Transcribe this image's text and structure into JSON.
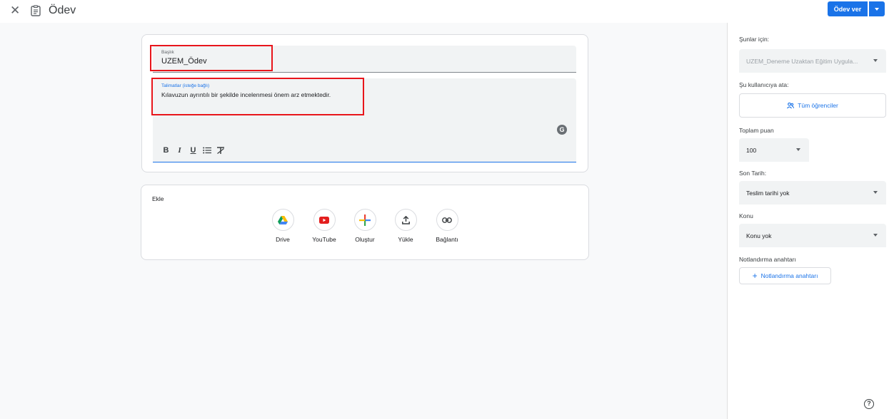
{
  "header": {
    "close_glyph": "✕",
    "title": "Ödev",
    "assign_label": "Ödev ver"
  },
  "form": {
    "title_label": "Başlık",
    "title_value": "UZEM_Ödev",
    "instructions_label": "Talimatlar (isteğe bağlı)",
    "instructions_value": "Kılavuzun ayrıntılı bir şekilde incelenmesi önem arz etmektedir.",
    "grammarly_glyph": "G",
    "toolbar": [
      {
        "name": "bold-button",
        "glyph": "B"
      },
      {
        "name": "italic-button",
        "glyph": "I"
      },
      {
        "name": "underline-button",
        "glyph": "U"
      },
      {
        "name": "bulleted-list-button",
        "glyph": "☰"
      },
      {
        "name": "clear-formatting-button",
        "glyph": "T̸"
      }
    ]
  },
  "attach": {
    "label": "Ekle",
    "items": [
      {
        "label": "Drive",
        "icon": "drive-icon"
      },
      {
        "label": "YouTube",
        "icon": "youtube-icon"
      },
      {
        "label": "Oluştur",
        "icon": "create-icon"
      },
      {
        "label": "Yükle",
        "icon": "upload-icon"
      },
      {
        "label": "Bağlantı",
        "icon": "link-icon"
      }
    ]
  },
  "sidebar": {
    "for_label": "Şunlar için:",
    "for_value": "UZEM_Deneme Uzaktan Eğitim Uygula...",
    "assign_to_label": "Şu kullanıcıya ata:",
    "assign_to_value": "Tüm öğrenciler",
    "points_label": "Toplam puan",
    "points_value": "100",
    "due_label": "Son Tarih:",
    "due_value": "Teslim tarihi yok",
    "topic_label": "Konu",
    "topic_value": "Konu yok",
    "rubric_label": "Notlandırma anahtarı",
    "rubric_button": "Notlandırma anahtarı",
    "rubric_plus": "+"
  },
  "colors": {
    "accent": "#1a73e8",
    "highlight": "#e8151b"
  },
  "help_glyph": "?"
}
